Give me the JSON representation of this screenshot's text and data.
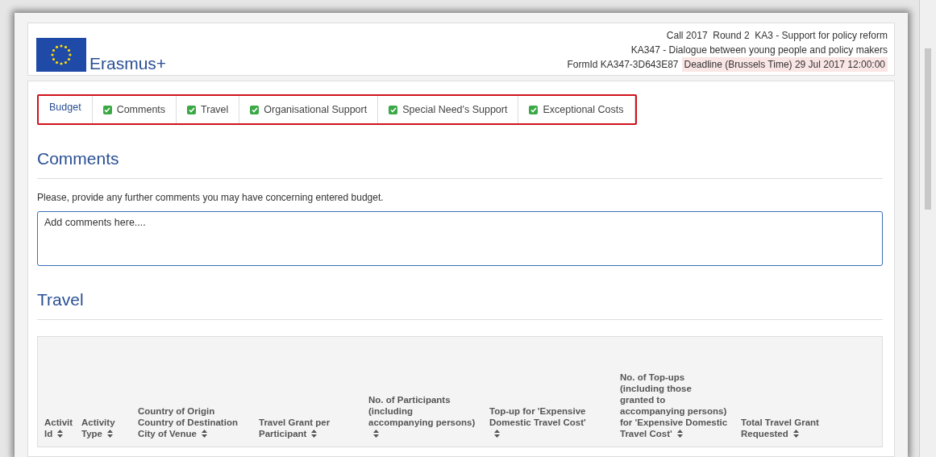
{
  "header": {
    "brand": "Erasmus+",
    "call_line": "Call 2017  Round 2  KA3 - Support for policy reform",
    "action_line": "KA347 - Dialogue between young people and policy makers",
    "form_id": "FormId KA347-3D643E87",
    "deadline": "Deadline (Brussels Time) 29 Jul 2017 12:00:00"
  },
  "tabs": [
    {
      "label": "Budget",
      "selected": true,
      "checked": false
    },
    {
      "label": "Comments",
      "selected": false,
      "checked": true
    },
    {
      "label": "Travel",
      "selected": false,
      "checked": true
    },
    {
      "label": "Organisational Support",
      "selected": false,
      "checked": true
    },
    {
      "label": "Special Need's Support",
      "selected": false,
      "checked": true
    },
    {
      "label": "Exceptional Costs",
      "selected": false,
      "checked": true
    }
  ],
  "comments": {
    "title": "Comments",
    "instruction": "Please, provide any further comments you may have concerning entered budget.",
    "value": "Add comments here...."
  },
  "travel": {
    "title": "Travel",
    "columns": [
      {
        "label": "Activit\nId"
      },
      {
        "label": "Activity\nType"
      },
      {
        "label": "Country of Origin\nCountry of Destination\nCity of Venue"
      },
      {
        "label": "Travel Grant per\nParticipant"
      },
      {
        "label": "No. of Participants\n(including\naccompanying persons)\n"
      },
      {
        "label": "Top-up for 'Expensive\nDomestic Travel Cost'\n"
      },
      {
        "label": "No. of Top-ups\n(including those\ngranted to\naccompanying persons)\nfor 'Expensive Domestic\nTravel Cost'"
      },
      {
        "label": "Total Travel Grant\nRequested"
      }
    ]
  }
}
